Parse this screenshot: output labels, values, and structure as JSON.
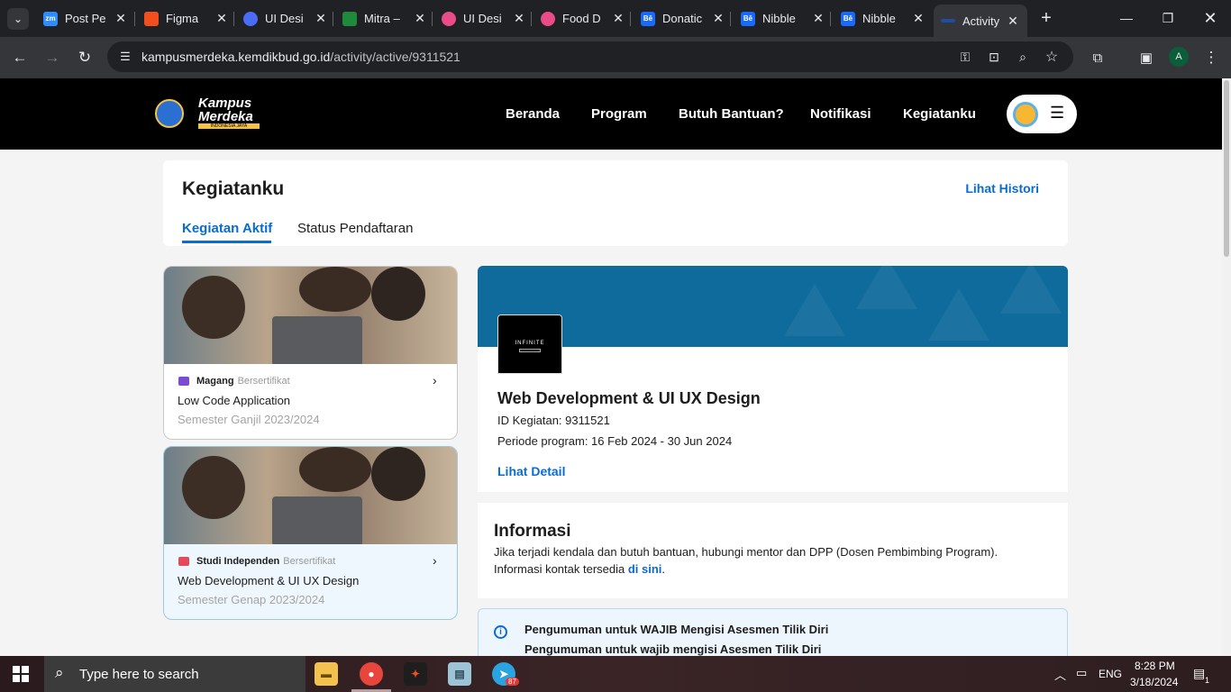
{
  "browser": {
    "tabs": [
      {
        "label": "Post Pe",
        "icon": "zoom-icon",
        "color": "#2d8cff"
      },
      {
        "label": "Figma",
        "icon": "figma-icon",
        "color": "#f24e1e"
      },
      {
        "label": "UI Desi",
        "icon": "ui-design-icon",
        "color": "#4a6cf7"
      },
      {
        "label": "Mitra –",
        "icon": "mitra-icon",
        "color": "#1f8a3b"
      },
      {
        "label": "UI Desi",
        "icon": "dribbble-icon",
        "color": "#ea4c89"
      },
      {
        "label": "Food D",
        "icon": "dribbble-icon",
        "color": "#ea4c89"
      },
      {
        "label": "Donatic",
        "icon": "behance-icon",
        "color": "#1769ff"
      },
      {
        "label": "Nibble",
        "icon": "behance-icon",
        "color": "#1769ff"
      },
      {
        "label": "Nibble",
        "icon": "behance-icon",
        "color": "#1769ff"
      },
      {
        "label": "Activity",
        "icon": "kampus-merdeka-icon",
        "color": "#1d4ea3"
      }
    ],
    "url_host": "kampusmerdeka.kemdikbud.go.id",
    "url_path": "/activity/active/9311521",
    "profile_initial": "A"
  },
  "site": {
    "logo_line1": "Kampus",
    "logo_line2": "Merdeka",
    "logo_sub": "INDONESIA JAYA",
    "nav": [
      "Beranda",
      "Program",
      "Butuh Bantuan?",
      "Notifikasi",
      "Kegiatanku"
    ]
  },
  "page": {
    "title": "Kegiatanku",
    "history_link": "Lihat Histori",
    "tabs": [
      "Kegiatan Aktif",
      "Status Pendaftaran"
    ],
    "cards": [
      {
        "type": "Magang",
        "cert": "Bersertifikat",
        "title": "Low Code Application",
        "semester": "Semester Ganjil 2023/2024",
        "badge_color": "#7b4cd1"
      },
      {
        "type": "Studi Independen",
        "cert": "Bersertifikat",
        "title": "Web Development & UI UX Design",
        "semester": "Semester Genap 2023/2024",
        "badge_color": "#e24b57"
      }
    ],
    "detail": {
      "company_logo_text": "INFINITE",
      "title": "Web Development & UI UX Design",
      "id_line": "ID Kegiatan: 9311521",
      "period_line": "Periode program: 16 Feb 2024 - 30 Jun 2024",
      "link": "Lihat Detail"
    },
    "info": {
      "title": "Informasi",
      "line1": "Jika terjadi kendala dan butuh bantuan, hubungi mentor dan DPP (Dosen Pembimbing Program).",
      "line2_prefix": "Informasi kontak tersedia ",
      "line2_link": "di sini",
      "line2_suffix": "."
    },
    "announcement": {
      "line1": "Pengumuman untuk WAJIB Mengisi Asesmen Tilik Diri",
      "line2": "Pengumuman untuk wajib mengisi Asesmen Tilik Diri"
    }
  },
  "taskbar": {
    "search_placeholder": "Type here to search",
    "telegram_badge": "87",
    "language": "ENG",
    "time": "8:28 PM",
    "date": "3/18/2024",
    "notifications": "1"
  }
}
